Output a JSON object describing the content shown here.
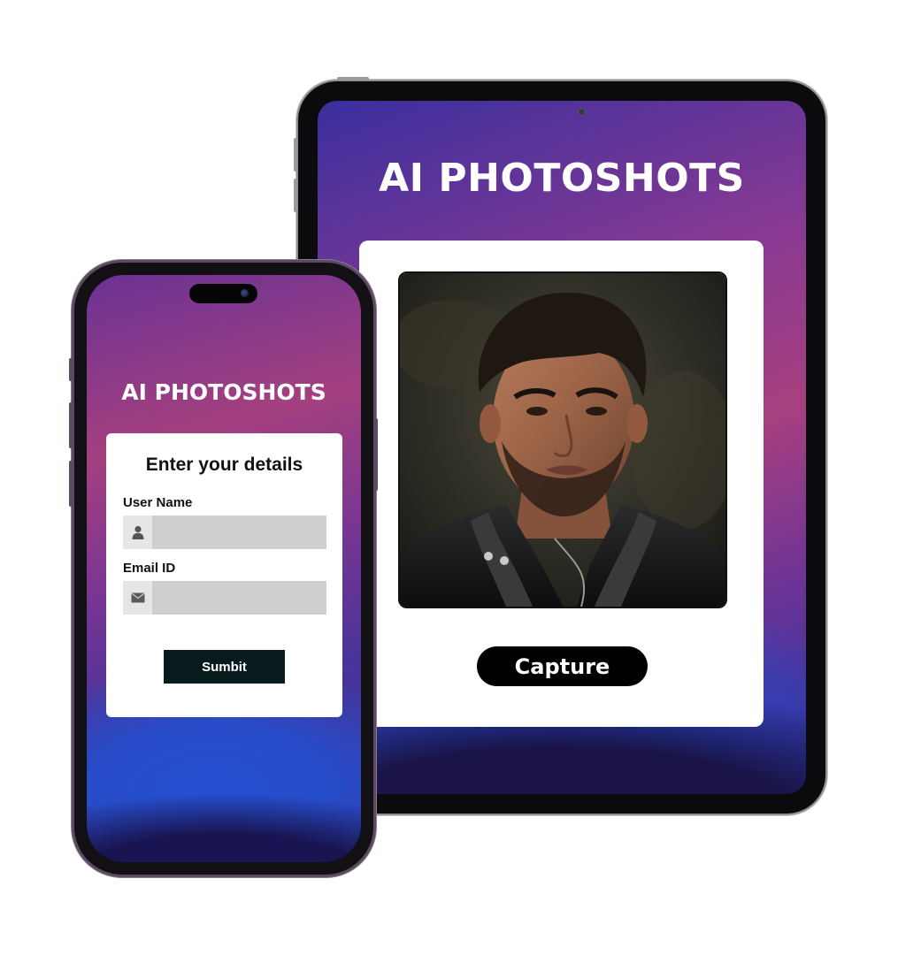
{
  "tablet": {
    "title": "AI PHOTOSHOTS",
    "capture_label": "Capture"
  },
  "phone": {
    "title": "AI PHOTOSHOTS",
    "form": {
      "heading": "Enter your details",
      "username_label": "User Name",
      "username_value": "",
      "email_label": "Email ID",
      "email_value": "",
      "submit_label": "Sumbit"
    },
    "icons": {
      "username": "user-icon",
      "email": "envelope-icon"
    }
  },
  "colors": {
    "gradient_purple": "#a8407f",
    "gradient_blue": "#2348c8",
    "card_bg": "#ffffff",
    "capture_button": "#000000",
    "submit_button": "#071a1c",
    "input_bg": "#cfcfcf"
  }
}
